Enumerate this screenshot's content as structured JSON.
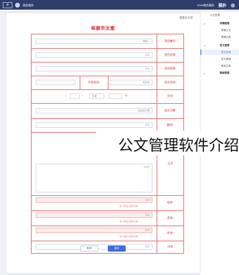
{
  "topbar": {
    "chip_label": "首",
    "app_name": "政务服务",
    "logo": "猫扑",
    "user_text": "2020政务服务"
  },
  "main": {
    "head_link": "查看本文案",
    "doc_title": "单据市文案"
  },
  "form": {
    "rows": [
      {
        "label": "项目编号*",
        "placeholder": "请输入",
        "count": ""
      },
      {
        "label": "项目名称*",
        "placeholder": "请输入",
        "count": "0/50"
      },
      {
        "label": "项目简称*",
        "placeholder": "请输入",
        "count": "0/50"
      },
      {
        "label": "发文机关*",
        "placeholder": "请选择",
        "count": ""
      },
      {
        "label": "文号*",
        "placeholder": "",
        "count": ""
      },
      {
        "label": "成文日期*",
        "placeholder": "",
        "count": "请选择日期"
      },
      {
        "label": "题目*",
        "placeholder": "请输入",
        "count": "0/50"
      },
      {
        "label": "正文",
        "placeholder": "请输入",
        "count": "0/500"
      },
      {
        "label": "附件*",
        "placeholder": "",
        "count": "0/50"
      },
      {
        "label": "发送*",
        "placeholder": "",
        "count": "0/50"
      },
      {
        "label": "抄送*",
        "placeholder": "",
        "count": "0/50"
      },
      {
        "label": "印发",
        "placeholder": "",
        "count": "0/50"
      }
    ],
    "split_label": "印发机关*",
    "split_value": "请选择",
    "wenhao_parts": [
      "〔",
      "〕",
      "年度",
      "号"
    ],
    "hint_text": "多个单位以顿号分隔",
    "cancel_label": "取消",
    "save_label": "保存"
  },
  "sidebar": {
    "items": [
      {
        "label": "公文处理",
        "type": "group"
      },
      {
        "label": "草稿管理",
        "type": "section"
      },
      {
        "label": "草稿公文",
        "type": "item"
      },
      {
        "label": "草稿文案",
        "type": "item"
      },
      {
        "label": "发文管理",
        "type": "section"
      },
      {
        "label": "发文文案",
        "type": "item",
        "active": true
      },
      {
        "label": "发文草稿",
        "type": "item"
      },
      {
        "label": "审批文案",
        "type": "item"
      },
      {
        "label": "模板管理",
        "type": "section"
      }
    ]
  },
  "overlay": {
    "caption": "公文管理软件介绍"
  }
}
